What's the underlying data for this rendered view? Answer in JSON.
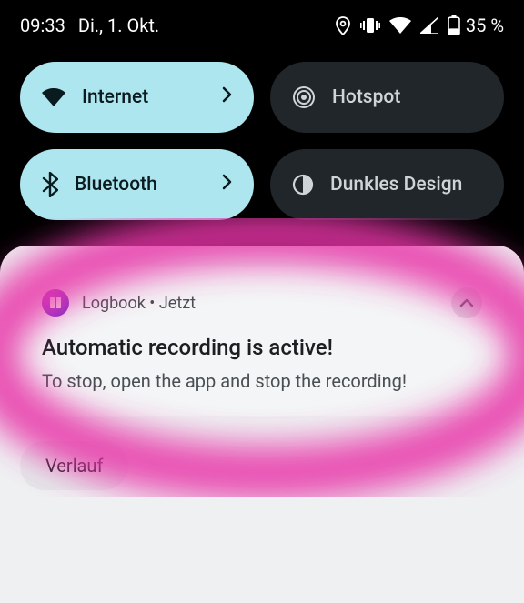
{
  "status": {
    "time": "09:33",
    "date": "Di., 1. Okt.",
    "battery_pct": "35 %"
  },
  "qs": {
    "internet": {
      "label": "Internet"
    },
    "hotspot": {
      "label": "Hotspot"
    },
    "bluetooth": {
      "label": "Bluetooth"
    },
    "dark": {
      "label": "Dunkles Design"
    }
  },
  "notif": {
    "app": "Logbook",
    "separator": " • ",
    "when": "Jetzt",
    "title": "Automatic recording is active!",
    "body": "To stop, open the app and stop the recording!"
  },
  "history_btn": "Verlauf",
  "colors": {
    "tile_active": "#aee6f0",
    "tile_inactive": "#21262b",
    "highlight": "#e836a8"
  }
}
